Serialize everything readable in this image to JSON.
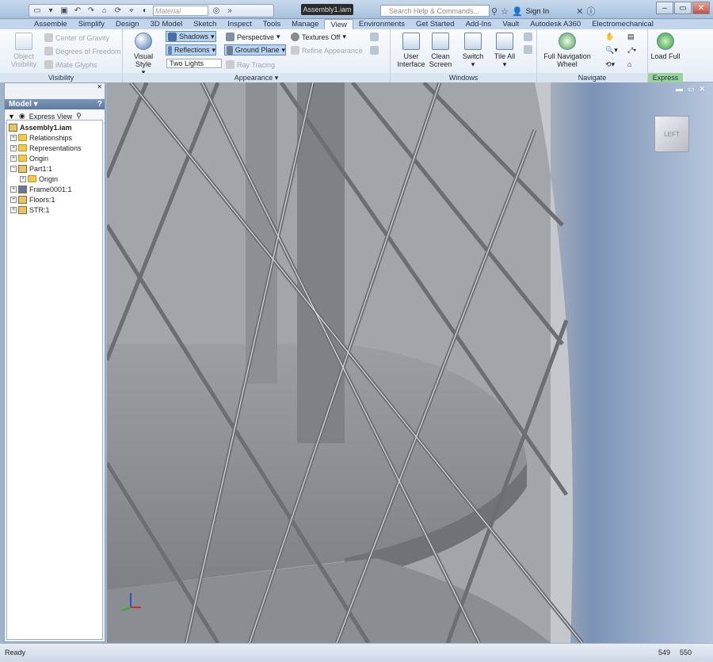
{
  "app": {
    "window_title": "Assembly1.iam",
    "search_placeholder": "Search Help & Commands...",
    "sign_in": "Sign In",
    "material": "Material"
  },
  "tabs": [
    "Assemble",
    "Simplify",
    "Design",
    "3D Model",
    "Sketch",
    "Inspect",
    "Tools",
    "Manage",
    "View",
    "Environments",
    "Get Started",
    "Add-Ins",
    "Vault",
    "Autodesk A360",
    "Electromechanical"
  ],
  "active_tab": "View",
  "ribbon": {
    "visibility": {
      "label": "Visibility",
      "object_visibility": "Object Visibility",
      "center_of_gravity": "Center of Gravity",
      "degrees_of_freedom": "Degrees of Freedom",
      "imate_glyphs": "iMate Glyphs"
    },
    "appearance": {
      "label": "Appearance",
      "visual_style": "Visual Style",
      "shadows": "Shadows",
      "reflections": "Reflections",
      "lighting": "Two Lights",
      "perspective": "Perspective",
      "ground_plane": "Ground Plane",
      "ray_tracing": "Ray Tracing",
      "textures_off": "Textures Off",
      "refine_appearance": "Refine Appearance"
    },
    "windows": {
      "label": "Windows",
      "user_interface": "User Interface",
      "clean_screen": "Clean Screen",
      "switch": "Switch",
      "tile_all": "Tile All"
    },
    "navigate": {
      "label": "Navigate",
      "full_navigation_wheel": "Full Navigation Wheel"
    },
    "express": {
      "label": "Express",
      "load_full": "Load Full"
    }
  },
  "browser": {
    "title": "Model",
    "express_view": "Express View",
    "tree": [
      "Assembly1.iam",
      "Relationships",
      "Representations",
      "Origin",
      "Part1:1",
      "Origin",
      "Frame0001:1",
      "Floors:1",
      "STR:1"
    ]
  },
  "viewcube": {
    "face": "LEFT"
  },
  "status": {
    "text": "Ready",
    "val1": "549",
    "val2": "550"
  }
}
